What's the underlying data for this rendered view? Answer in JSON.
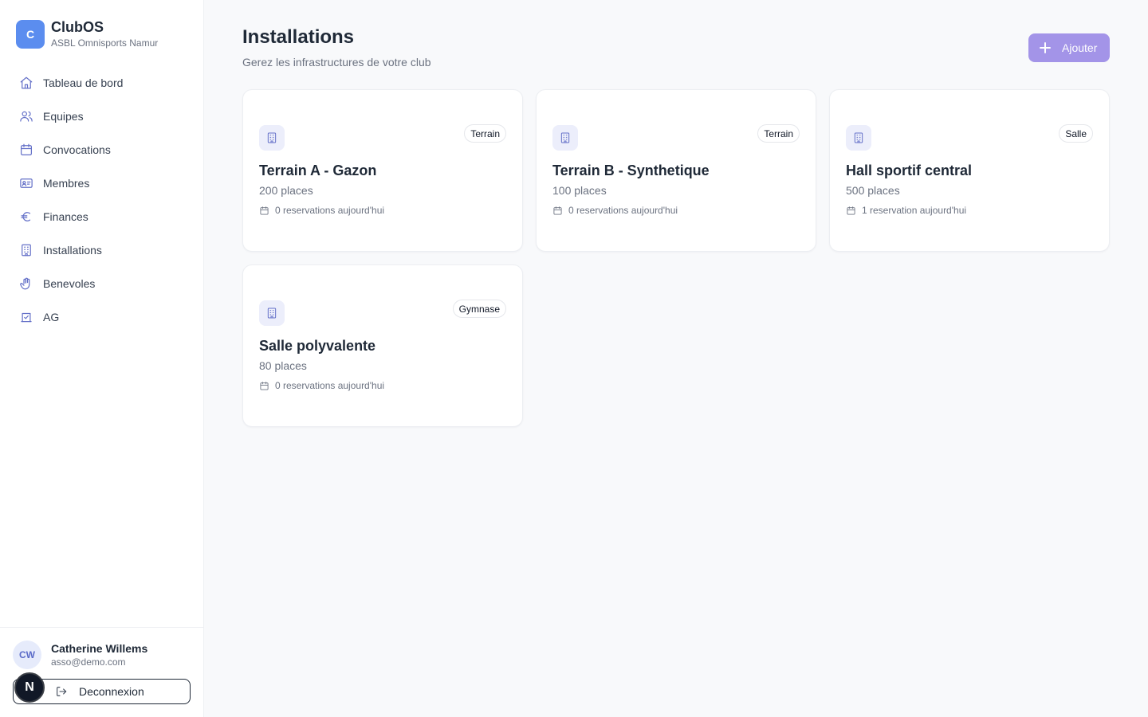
{
  "brand": {
    "logo_letter": "C",
    "name": "ClubOS",
    "subtitle": "ASBL Omnisports Namur"
  },
  "nav": [
    {
      "label": "Tableau de bord",
      "icon": "home-icon"
    },
    {
      "label": "Equipes",
      "icon": "users-icon"
    },
    {
      "label": "Convocations",
      "icon": "calendar-icon"
    },
    {
      "label": "Membres",
      "icon": "id-card-icon"
    },
    {
      "label": "Finances",
      "icon": "euro-icon"
    },
    {
      "label": "Installations",
      "icon": "building-icon"
    },
    {
      "label": "Benevoles",
      "icon": "hand-icon"
    },
    {
      "label": "AG",
      "icon": "vote-icon"
    }
  ],
  "user": {
    "initials": "CW",
    "name": "Catherine Willems",
    "email": "asso@demo.com"
  },
  "logout_label": "Deconnexion",
  "n_badge": "N",
  "page": {
    "title": "Installations",
    "subtitle": "Gerez les infrastructures de votre club",
    "add_label": "Ajouter"
  },
  "facilities": [
    {
      "name": "Terrain A - Gazon",
      "type": "Terrain",
      "capacity": "200 places",
      "reservations": "0 reservations aujourd'hui"
    },
    {
      "name": "Terrain B - Synthetique",
      "type": "Terrain",
      "capacity": "100 places",
      "reservations": "0 reservations aujourd'hui"
    },
    {
      "name": "Hall sportif central",
      "type": "Salle",
      "capacity": "500 places",
      "reservations": "1 reservation aujourd'hui"
    },
    {
      "name": "Salle polyvalente",
      "type": "Gymnase",
      "capacity": "80 places",
      "reservations": "0 reservations aujourd'hui"
    }
  ],
  "colors": {
    "accent": "#6470c8",
    "brand_logo": "#5b8def",
    "add_button": "#a394e8",
    "background": "#f8f9fb"
  }
}
